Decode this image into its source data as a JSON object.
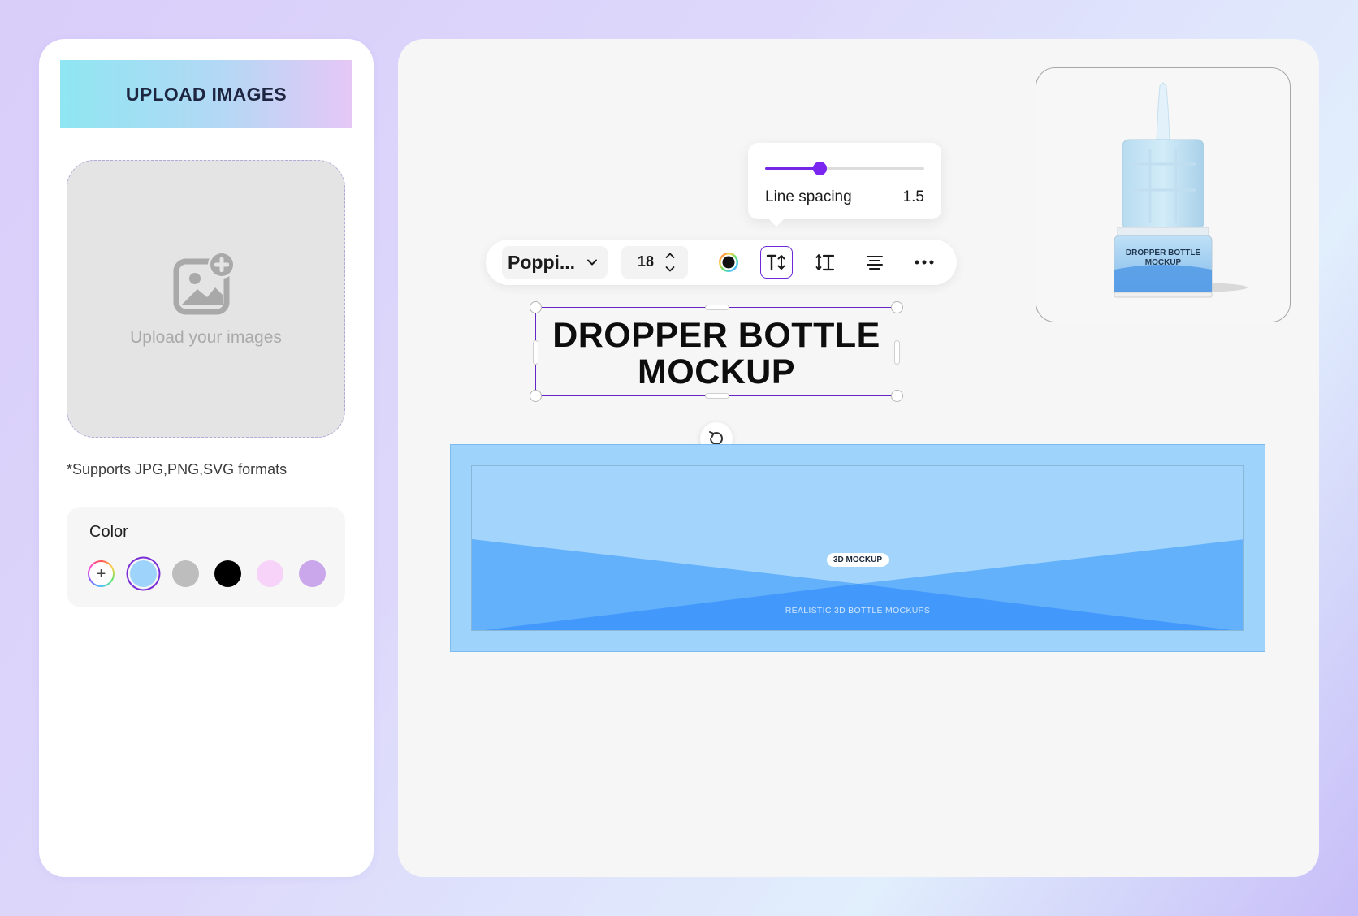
{
  "sidebar": {
    "upload_header": "UPLOAD IMAGES",
    "dropzone_text": "Upload your images",
    "supports_note": "*Supports JPG,PNG,SVG formats",
    "color_title": "Color",
    "swatches": [
      {
        "name": "add-color",
        "color": "#ffffff"
      },
      {
        "name": "light-blue",
        "color": "#9ed3fb",
        "selected": true
      },
      {
        "name": "gray",
        "color": "#bdbdbd"
      },
      {
        "name": "black",
        "color": "#000000"
      },
      {
        "name": "light-pink",
        "color": "#f7d2f9"
      },
      {
        "name": "lavender",
        "color": "#c9a7ea"
      }
    ]
  },
  "toolbar": {
    "font_name": "Poppi...",
    "font_size": "18",
    "icons": [
      "color-picker-icon",
      "text-size-icon",
      "line-height-icon",
      "align-center-icon",
      "more-options-icon"
    ]
  },
  "line_spacing": {
    "label": "Line spacing",
    "value": "1.5",
    "fraction": 0.34
  },
  "canvas": {
    "title_line1": "DROPPER BOTTLE",
    "title_line2": "MOCKUP",
    "banner_badge": "3D MOCKUP",
    "banner_caption": "REALISTIC 3D BOTTLE MOCKUPS"
  },
  "preview": {
    "label_line1": "DROPPER BOTTLE",
    "label_line2": "MOCKUP"
  },
  "colors": {
    "accent": "#7428e6",
    "banner_light": "#9ed3fb",
    "banner_mid": "#63b0fb",
    "banner_dark": "#4299fb"
  }
}
